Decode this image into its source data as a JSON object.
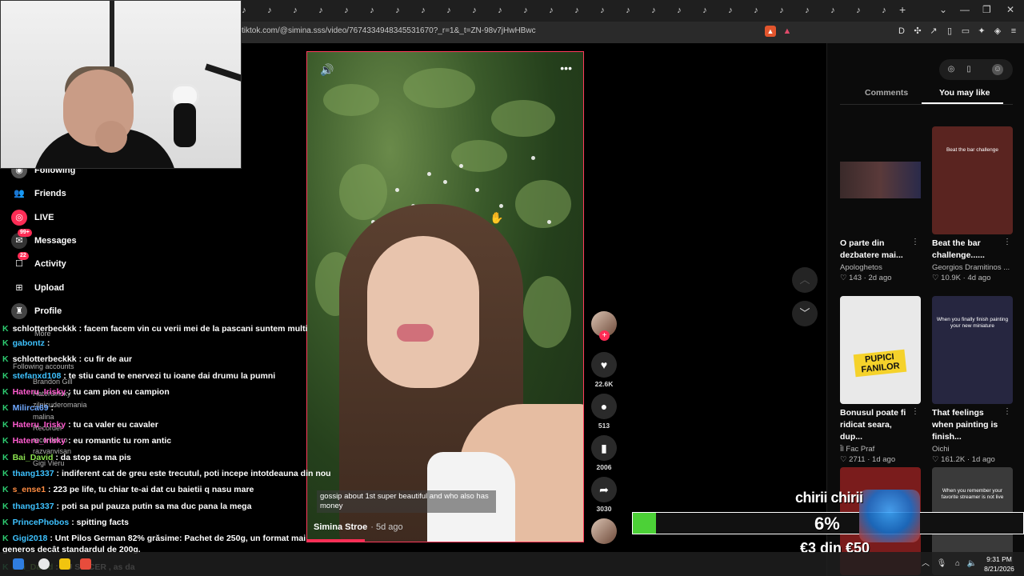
{
  "browser": {
    "url": "tiktok.com/@simina.sss/video/7674334948345531670?_r=1&_t=ZN-98v7jHwHBwc",
    "new_tab_icon": "plus-icon"
  },
  "sidebar": {
    "items": [
      {
        "label": "Following",
        "icon": "following-icon"
      },
      {
        "label": "Friends",
        "icon": "friends-icon"
      },
      {
        "label": "LIVE",
        "icon": "live-icon"
      },
      {
        "label": "Messages",
        "icon": "messages-icon",
        "badge": "99+"
      },
      {
        "label": "Activity",
        "icon": "activity-icon",
        "badge": "22"
      },
      {
        "label": "Upload",
        "icon": "upload-icon"
      },
      {
        "label": "Profile",
        "icon": "profile-icon"
      }
    ],
    "more": "More",
    "following_accounts": "Following accounts",
    "ghost_accounts": [
      "Brandon Gill",
      "Hateruirisky",
      "zilnicuderomania",
      "malina",
      "Recorder",
      "recorder.ro",
      "razvanvisan",
      "Gigi Vieru"
    ]
  },
  "chat": {
    "messages": [
      {
        "user": "schlotterbeckkk",
        "color": "#ffffff",
        "text": ": facem facem vin cu verii mei de la pascani suntem multi"
      },
      {
        "user": "gabontz",
        "color": "#3ec2ff",
        "text": ":"
      },
      {
        "user": "schlotterbeckkk",
        "color": "#ffffff",
        "text": ": cu fir de aur"
      },
      {
        "user": "stefanxd108",
        "color": "#3ec2ff",
        "text": ": te stiu cand te enervezi tu ioane dai drumu la pumni"
      },
      {
        "user": "Hateru_Irisky",
        "color": "#ff5ccf",
        "text": ": tu cam pion eu campion"
      },
      {
        "user": "Milirca69",
        "color": "#6fa8ff",
        "text": ":"
      },
      {
        "user": "Hateru_Irisky",
        "color": "#ff5ccf",
        "text": ": tu ca valer eu cavaler"
      },
      {
        "user": "Hateru_Irisky",
        "color": "#ff5ccf",
        "text": ": eu romantic tu rom antic"
      },
      {
        "user": "Bai_David",
        "color": "#8be14f",
        "text": ": da stop sa ma pis"
      },
      {
        "user": "thang1337",
        "color": "#3ec2ff",
        "text": ": indiferent cat de greu este trecutul, poti incepe intotdeauna din nou"
      },
      {
        "user": "s_ense1",
        "color": "#ff8c42",
        "text": ": 223 pe life, tu chiar te-ai dat cu baietii q nasu mare"
      },
      {
        "user": "thang1337",
        "color": "#3ec2ff",
        "text": ": poti sa pul pauza putin sa ma duc pana la mega"
      },
      {
        "user": "PrincePhobos",
        "color": "#3ec2ff",
        "text": ": spitting facts"
      },
      {
        "user": "Gigi2018",
        "color": "#3ec2ff",
        "text": ": Unt Pilos German 82% grăsime: Pachet de 250g, un format mai generos decât standardul de 200g."
      },
      {
        "user": "Bai_David",
        "color": "#8be14f",
        "text": ": EU SINCER , as da"
      }
    ]
  },
  "video": {
    "caption": "gossip about 1st super beautiful and who also has money",
    "author": "Simina Stroe",
    "date": "· 5d ago",
    "progress_percent": 21,
    "volume_icon": "volume-icon",
    "more_icon": "more-icon"
  },
  "actions": {
    "likes": "22.6K",
    "comments": "513",
    "saves": "2006",
    "shares": "3030"
  },
  "panel": {
    "tabs": [
      "Comments",
      "You may like"
    ],
    "active_tab": "You may like",
    "cards": [
      {
        "title": "O parte din dezbatere mai...",
        "author": "Apologhetos",
        "likes": "143",
        "age": "2d ago",
        "thumb_text": "",
        "thumb_bg": "#202020"
      },
      {
        "title": "Beat the bar challenge......",
        "author": "Georgios Dramitinos ...",
        "likes": "10.9K",
        "age": "4d ago",
        "thumb_text": "Beat the bar challenge",
        "thumb_bg": "#5a2420"
      },
      {
        "title": "Bonusul poate fi ridicat seara, dup...",
        "author": "Îl Fac Praf",
        "likes": "2711",
        "age": "1d ago",
        "thumb_text": "PUPICI FANILOR",
        "thumb_bg": "#e9e9e9"
      },
      {
        "title": "That feelings when painting is finish...",
        "author": "Oichi",
        "likes": "161.2K",
        "age": "1d ago",
        "thumb_text": "When you finally finish painting your new miniature",
        "thumb_bg": "#262640"
      },
      {
        "title": "",
        "author": "",
        "likes": "",
        "age": "",
        "thumb_text": "",
        "thumb_bg": "#7a1c1c"
      },
      {
        "title": "",
        "author": "",
        "likes": "",
        "age": "",
        "thumb_text": "When you remember your favorite streamer is not live",
        "thumb_bg": "#3a3a3a"
      }
    ]
  },
  "donation": {
    "title": "chirii chirii",
    "percent_label": "6%",
    "progress_fraction": 0.06,
    "amount": "€3 din €50",
    "accent": "#4cd137"
  },
  "taskbar": {
    "time": "9:31 PM",
    "date": "8/21/2026"
  }
}
